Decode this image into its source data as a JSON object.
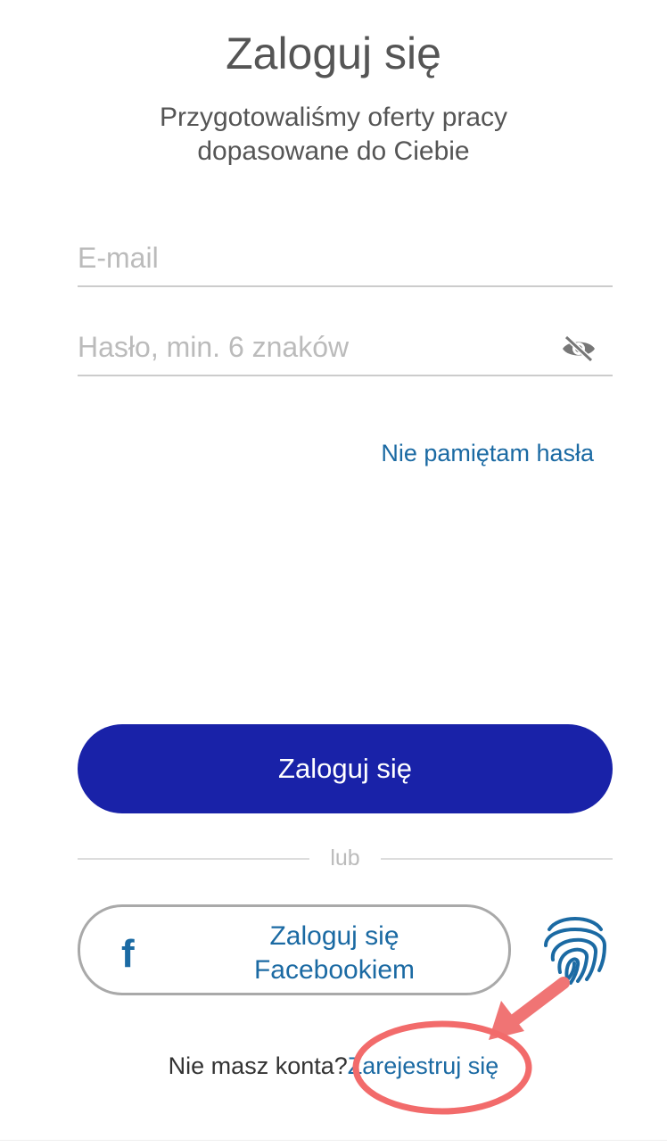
{
  "header": {
    "title": "Zaloguj się",
    "subtitle_line1": "Przygotowaliśmy oferty pracy",
    "subtitle_line2": "dopasowane do Ciebie"
  },
  "form": {
    "email_placeholder": "E-mail",
    "email_value": "",
    "password_placeholder": "Hasło, min. 6 znaków",
    "password_value": "",
    "password_toggle_icon": "eye-off-icon",
    "forgot_password": "Nie pamiętam hasła",
    "login_button": "Zaloguj się"
  },
  "divider": {
    "label": "lub"
  },
  "social": {
    "facebook_icon": "facebook-icon",
    "facebook_label_line1": "Zaloguj się",
    "facebook_label_line2": "Facebookiem",
    "fingerprint_icon": "fingerprint-icon"
  },
  "footer": {
    "no_account": "Nie masz konta?",
    "register_link": "Zarejestruj się"
  },
  "colors": {
    "primary": "#1922a8",
    "link": "#1b6aa3",
    "text": "#555555",
    "placeholder": "#bbbbbb",
    "annotation": "#f26b6b"
  }
}
